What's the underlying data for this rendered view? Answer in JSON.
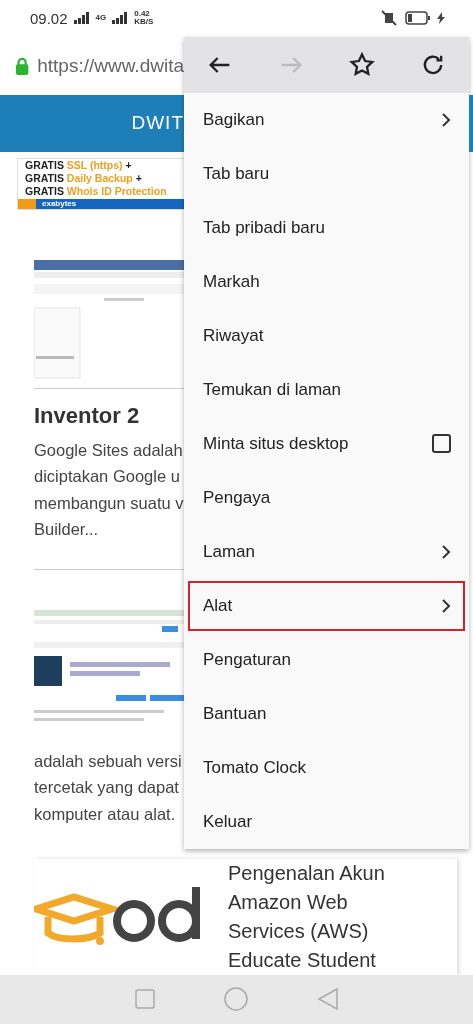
{
  "status_bar": {
    "time": "09.02",
    "network": "4G",
    "speed": "0.42",
    "speed_unit": "KB/S"
  },
  "address_bar": {
    "url": "https://www.dwita"
  },
  "site_header": {
    "title": "DWIT"
  },
  "ad": {
    "lines": [
      {
        "lead": "GRATIS",
        "highlight": "SSL (https)",
        "tail": "+"
      },
      {
        "lead": "GRATIS",
        "highlight": "Daily Backup",
        "tail": "+"
      },
      {
        "lead": "GRATIS",
        "highlight": "Whois ID Protection"
      }
    ],
    "brand": "exabytes"
  },
  "posts": [
    {
      "title": "Inventor 2",
      "excerpt": [
        "Google Sites adalah",
        "diciptakan Google u",
        "membangun suatu v",
        "Builder..."
      ]
    },
    {
      "excerpt": [
        "adalah sebuah versi",
        "tercetak yang dapat",
        "komputer atau alat."
      ]
    }
  ],
  "featured_post": {
    "title": [
      "Pengenalan Akun",
      "Amazon Web",
      "Services (AWS)",
      "Educate Student"
    ]
  },
  "menu": {
    "toolbar": [
      {
        "kind": "back",
        "disabled": false
      },
      {
        "kind": "forward",
        "disabled": true
      },
      {
        "kind": "bookmark",
        "disabled": false
      },
      {
        "kind": "reload",
        "disabled": false
      }
    ],
    "items": [
      {
        "label": "Bagikan",
        "kind": "submenu",
        "highlighted": false
      },
      {
        "label": "Tab baru",
        "kind": "plain",
        "highlighted": false
      },
      {
        "label": "Tab pribadi baru",
        "kind": "plain",
        "highlighted": false
      },
      {
        "label": "Markah",
        "kind": "plain",
        "highlighted": false
      },
      {
        "label": "Riwayat",
        "kind": "plain",
        "highlighted": false
      },
      {
        "label": "Temukan di laman",
        "kind": "plain",
        "highlighted": false
      },
      {
        "label": "Minta situs desktop",
        "kind": "checkbox",
        "checked": false,
        "highlighted": false
      },
      {
        "label": "Pengaya",
        "kind": "plain",
        "highlighted": false
      },
      {
        "label": "Laman",
        "kind": "submenu",
        "highlighted": false
      },
      {
        "label": "Alat",
        "kind": "submenu",
        "highlighted": true
      },
      {
        "label": "Pengaturan",
        "kind": "plain",
        "highlighted": false
      },
      {
        "label": "Bantuan",
        "kind": "plain",
        "highlighted": false
      },
      {
        "label": "Tomato Clock",
        "kind": "plain",
        "highlighted": false
      },
      {
        "label": "Keluar",
        "kind": "plain",
        "highlighted": false
      }
    ]
  }
}
